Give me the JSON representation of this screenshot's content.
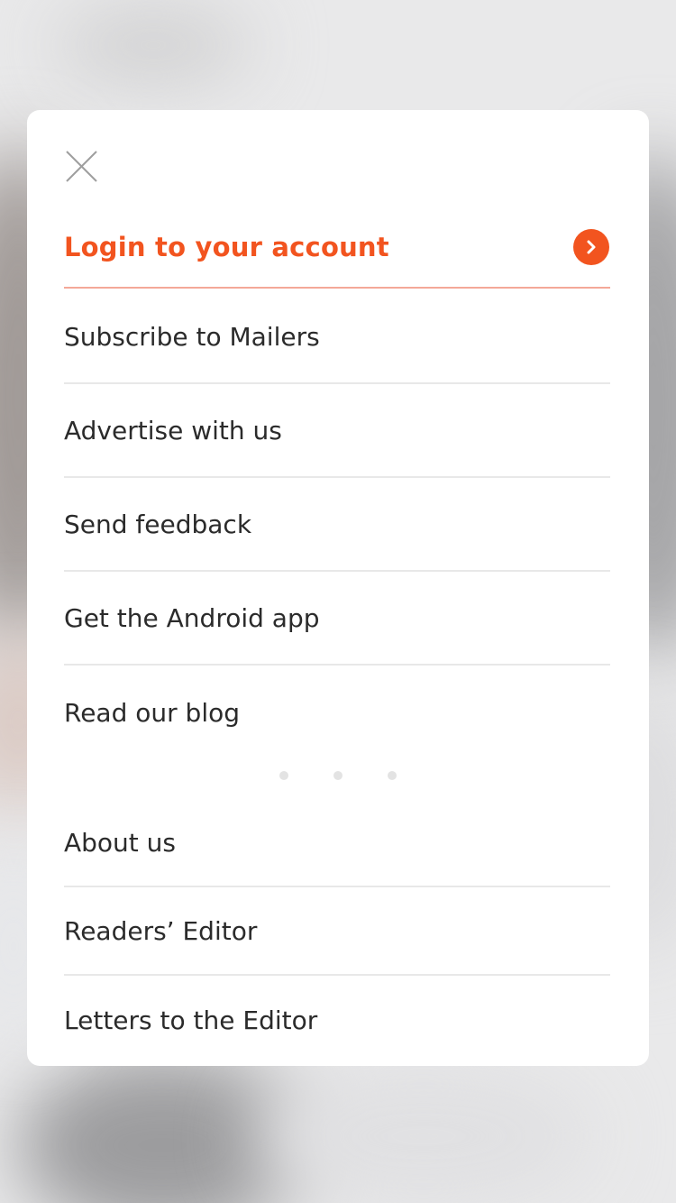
{
  "menu": {
    "close_icon": "close-icon",
    "login": {
      "label": "Login to your account",
      "icon": "chevron-right-icon",
      "accent_color": "#f2541f"
    },
    "items": [
      {
        "label": "Subscribe to Mailers"
      },
      {
        "label": "Advertise with us"
      },
      {
        "label": "Send feedback"
      },
      {
        "label": "Get the Android app"
      },
      {
        "label": "Read our blog"
      }
    ],
    "secondary_items": [
      {
        "label": "About us"
      },
      {
        "label": "Readers’ Editor"
      },
      {
        "label": "Letters to the Editor"
      }
    ]
  }
}
